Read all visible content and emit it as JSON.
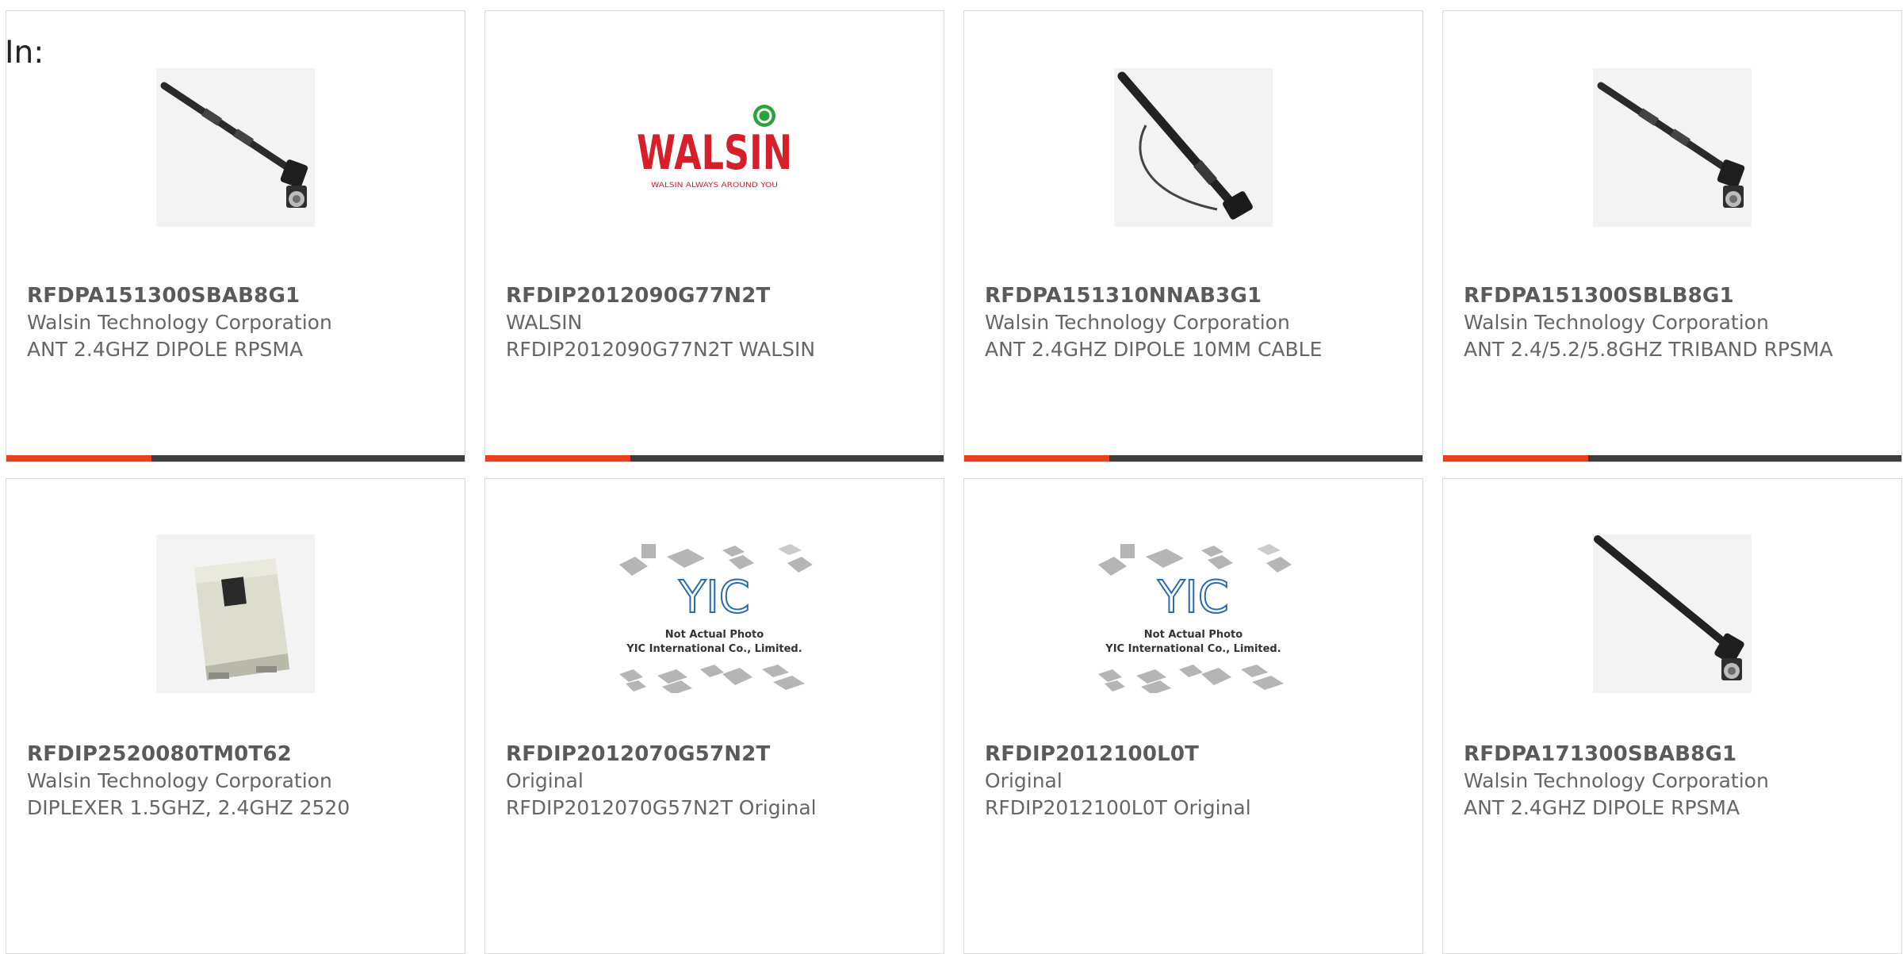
{
  "header": {
    "in_label": "In:"
  },
  "colors": {
    "accent": "#e8401c",
    "bar": "#3d3d3d"
  },
  "products": [
    {
      "part": "RFDPA151300SBAB8G1",
      "manufacturer": "Walsin Technology Corporation",
      "description": "ANT 2.4GHZ DIPOLE RPSMA",
      "image": "antenna-icon"
    },
    {
      "part": "RFDIP2012090G77N2T",
      "manufacturer": "WALSIN",
      "description": "RFDIP2012090G77N2T WALSIN",
      "image": "walsin-logo",
      "logo_text": "WALSIN",
      "logo_tagline": "WALSIN ALWAYS AROUND YOU"
    },
    {
      "part": "RFDPA151310NNAB3G1",
      "manufacturer": "Walsin Technology Corporation",
      "description": "ANT 2.4GHZ DIPOLE 10MM CABLE",
      "image": "antenna-cable-icon"
    },
    {
      "part": "RFDPA151300SBLB8G1",
      "manufacturer": "Walsin Technology Corporation",
      "description": "ANT 2.4/5.2/5.8GHZ TRIBAND RPSMA",
      "image": "antenna-icon"
    },
    {
      "part": "RFDIP2520080TM0T62",
      "manufacturer": "Walsin Technology Corporation",
      "description": "DIPLEXER 1.5GHZ, 2.4GHZ 2520",
      "image": "chip-component-icon"
    },
    {
      "part": "RFDIP2012070G57N2T",
      "manufacturer": "Original",
      "description": "RFDIP2012070G57N2T Original",
      "image": "yic-placeholder",
      "placeholder_logo": "YIC",
      "placeholder_line1": "Not Actual Photo",
      "placeholder_line2": "YIC International Co., Limited."
    },
    {
      "part": "RFDIP2012100L0T",
      "manufacturer": "Original",
      "description": "RFDIP2012100L0T Original",
      "image": "yic-placeholder",
      "placeholder_logo": "YIC",
      "placeholder_line1": "Not Actual Photo",
      "placeholder_line2": "YIC International Co., Limited."
    },
    {
      "part": "RFDPA171300SBAB8G1",
      "manufacturer": "Walsin Technology Corporation",
      "description": "ANT 2.4GHZ DIPOLE RPSMA",
      "image": "antenna-icon"
    }
  ]
}
